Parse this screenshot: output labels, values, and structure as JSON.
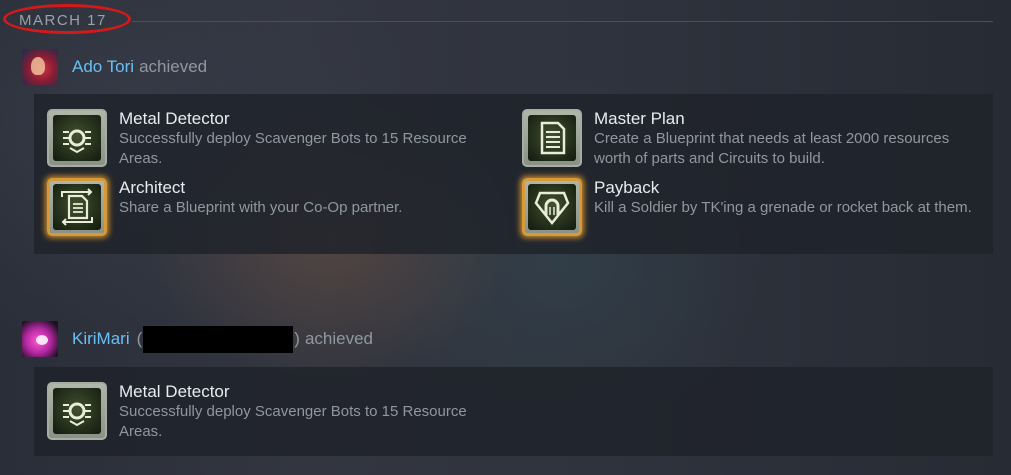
{
  "date_header": "MARCH 17",
  "entries": [
    {
      "user": "Ado Tori",
      "verb": "achieved",
      "achievements": [
        {
          "title": "Metal Detector",
          "desc": "Successfully deploy Scavenger Bots to 15 Resource Areas.",
          "icon": "scavenger-bot-icon"
        },
        {
          "title": "Master Plan",
          "desc": "Create a Blueprint that needs at least 2000 resources worth of parts and Circuits to build.",
          "icon": "document-icon"
        },
        {
          "title": "Architect",
          "desc": "Share a Blueprint with your Co-Op partner.",
          "icon": "shared-document-icon"
        },
        {
          "title": "Payback",
          "desc": "Kill a Soldier by TK'ing a grenade or rocket back at them.",
          "icon": "shield-magnet-icon"
        }
      ]
    },
    {
      "user": "KiriMari",
      "paren_open": "(",
      "paren_close": ")",
      "verb": "achieved",
      "achievements": [
        {
          "title": "Metal Detector",
          "desc": "Successfully deploy Scavenger Bots to 15 Resource Areas.",
          "icon": "scavenger-bot-icon"
        }
      ]
    }
  ],
  "colors": {
    "accent_name": "#66c0f4",
    "date_circle": "#d41919",
    "glow": "#d79a3a"
  }
}
